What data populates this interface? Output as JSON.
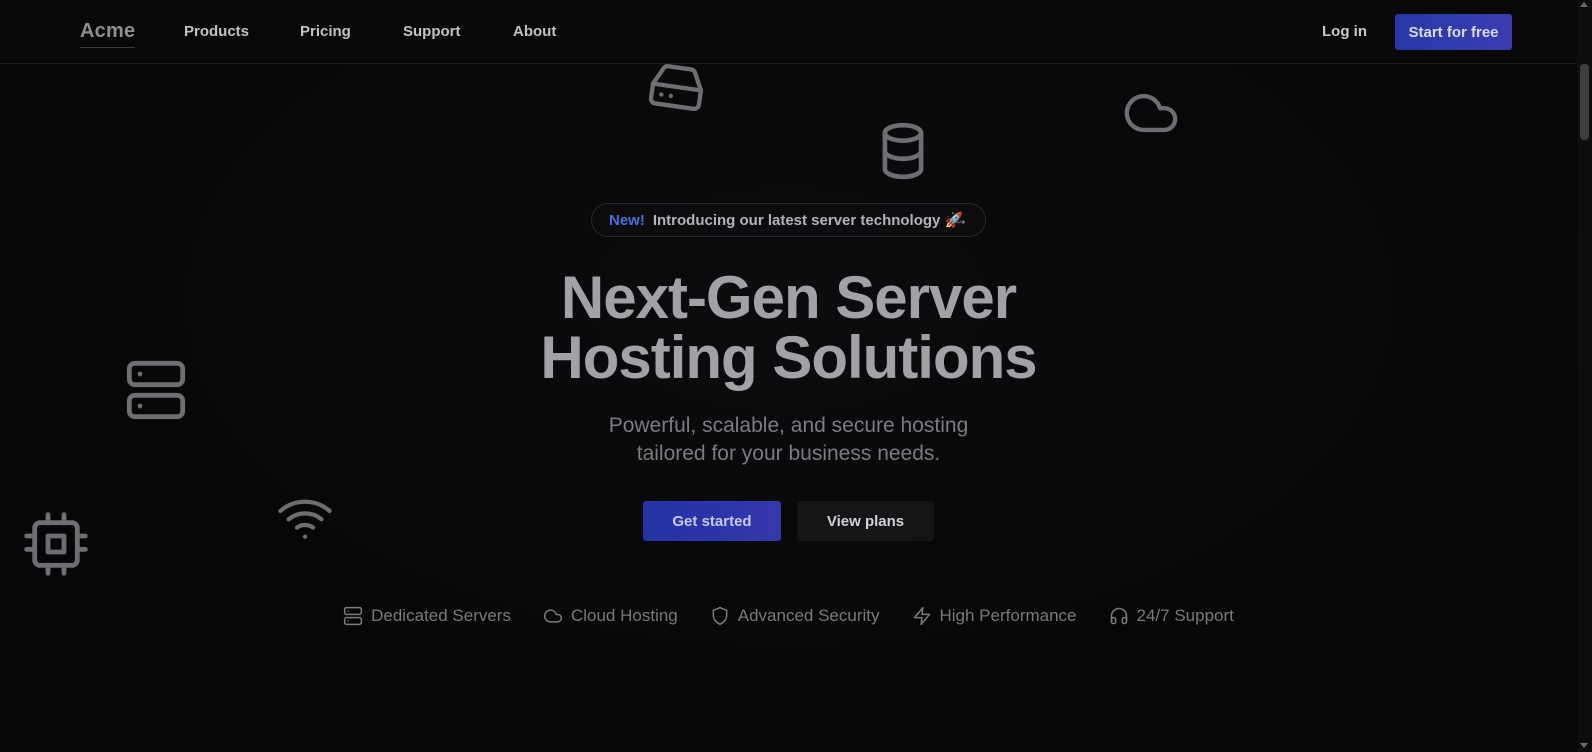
{
  "nav": {
    "logo": "Acme",
    "links": [
      "Products",
      "Pricing",
      "Support",
      "About"
    ],
    "login": "Log in",
    "cta": "Start for free"
  },
  "announcement": {
    "badge": "New!",
    "text": "Introducing our latest server technology 🚀",
    "arrow": "→"
  },
  "hero": {
    "title_line1": "Next-Gen Server",
    "title_line2": "Hosting Solutions",
    "subtitle_line1": "Powerful, scalable, and secure hosting",
    "subtitle_line2": "tailored for your business needs.",
    "primary_button": "Get started",
    "secondary_button": "View plans"
  },
  "features": [
    {
      "icon": "server-icon",
      "label": "Dedicated Servers"
    },
    {
      "icon": "cloud-icon",
      "label": "Cloud Hosting"
    },
    {
      "icon": "shield-icon",
      "label": "Advanced Security"
    },
    {
      "icon": "zap-icon",
      "label": "High Performance"
    },
    {
      "icon": "headphones-icon",
      "label": "24/7 Support"
    }
  ],
  "floating_icons": [
    "hard-drive-icon",
    "database-icon",
    "cloud-icon",
    "server-icon",
    "wifi-icon",
    "cpu-icon"
  ],
  "colors": {
    "accent": "#2c36a8",
    "new_badge": "#4a6fd8",
    "background": "#060607"
  }
}
